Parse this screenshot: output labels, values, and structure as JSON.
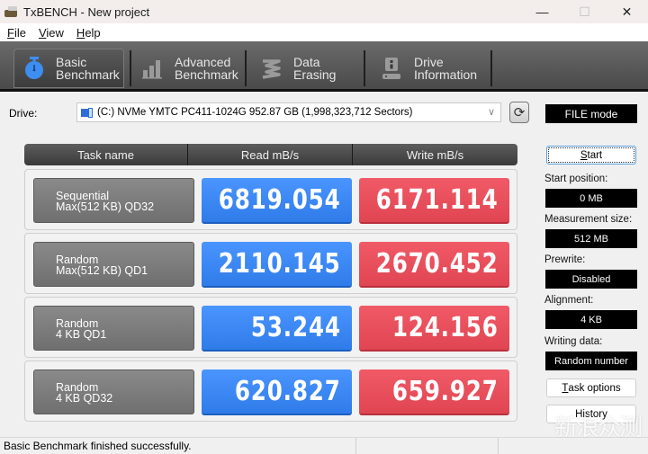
{
  "window": {
    "title": "TxBENCH - New project",
    "controls": {
      "minimize": "—",
      "maximize": "☐",
      "close": "✕"
    }
  },
  "menu": [
    {
      "label": "File",
      "accel": "F",
      "rest": "ile"
    },
    {
      "label": "View",
      "accel": "V",
      "rest": "iew"
    },
    {
      "label": "Help",
      "accel": "H",
      "rest": "elp"
    }
  ],
  "tabs": [
    {
      "line1": "Basic",
      "line2": "Benchmark",
      "icon": "stopwatch-icon",
      "active": true
    },
    {
      "line1": "Advanced",
      "line2": "Benchmark",
      "icon": "bar-chart-icon",
      "active": false
    },
    {
      "line1": "Data Erasing",
      "line2": "",
      "icon": "eraser-spring-icon",
      "active": false
    },
    {
      "line1": "Drive",
      "line2": "Information",
      "icon": "drive-info-icon",
      "active": false
    }
  ],
  "drive": {
    "label": "Drive:",
    "selected": "(C:) NVMe YMTC PC411-1024G  952.87 GB (1,998,323,712 Sectors)",
    "mode": "FILE mode"
  },
  "table": {
    "headers": [
      "Task name",
      "Read mB/s",
      "Write mB/s"
    ],
    "rows": [
      {
        "line1": "Sequential",
        "line2": "Max(512 KB) QD32",
        "read": "6819.054",
        "write": "6171.114"
      },
      {
        "line1": "Random",
        "line2": "Max(512 KB) QD1",
        "read": "2110.145",
        "write": "2670.452"
      },
      {
        "line1": "Random",
        "line2": "4 KB QD1",
        "read": "53.244",
        "write": "124.156"
      },
      {
        "line1": "Random",
        "line2": "4 KB QD32",
        "read": "620.827",
        "write": "659.927"
      }
    ]
  },
  "side": {
    "start_button": {
      "accel": "S",
      "rest": "tart"
    },
    "start_position": {
      "label": "Start position:",
      "value": "0 MB"
    },
    "measurement_size": {
      "label": "Measurement size:",
      "value": "512 MB"
    },
    "prewrite": {
      "label": "Prewrite:",
      "value": "Disabled"
    },
    "alignment": {
      "label": "Alignment:",
      "value": "4 KB"
    },
    "writing_data": {
      "label": "Writing data:",
      "value": "Random number"
    },
    "task_options_button": {
      "accel": "T",
      "rest": "ask options"
    },
    "history_button": {
      "label": "History"
    }
  },
  "status": {
    "text": "Basic Benchmark finished successfully."
  },
  "watermark": "新浪众测",
  "colors": {
    "read": "#3a86f4",
    "write": "#e84d5a",
    "tab_active_icon": "#3d8ef0"
  }
}
